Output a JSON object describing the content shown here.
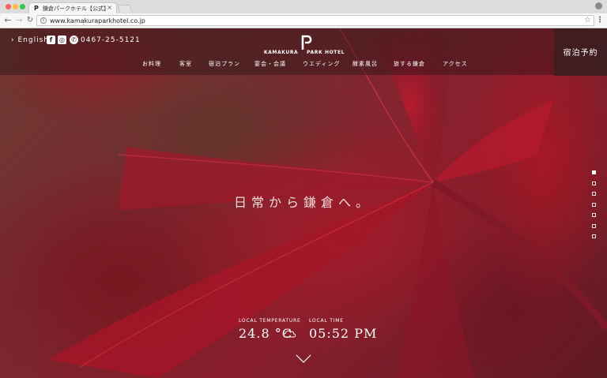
{
  "browser": {
    "tab_title": "鎌倉パークホテル【公式】 | Ka",
    "tab_close": "×",
    "url": "www.kamakuraparkhotel.co.jp",
    "icons": [
      "back-icon",
      "forward-icon",
      "reload-icon",
      "info-icon",
      "star-icon",
      "menu-icon",
      "profile-icon"
    ]
  },
  "header": {
    "lang_link": "› English",
    "phone": "0467-25-5121",
    "logo_top": "KAMAKURA",
    "logo_bottom": "PARK HOTEL",
    "reserve_label": "宿泊予約",
    "social_icons": [
      "facebook-icon",
      "instagram-icon",
      "phone-icon"
    ]
  },
  "nav": {
    "items": [
      "お料理",
      "客室",
      "宿泊プラン",
      "宴会・会議",
      "ウエディング",
      "酵素風呂",
      "旅する鎌倉",
      "アクセス"
    ]
  },
  "hero": {
    "tagline": "日常から鎌倉へ。",
    "slide_count": 7,
    "active_slide": 1
  },
  "weather": {
    "temp_label": "LOCAL TEMPERATURE",
    "temp_value": "24.8 °C",
    "time_label": "LOCAL TIME",
    "time_value": "05:52 PM",
    "condition_icon": "cloud-icon"
  },
  "colors": {
    "header_overlay": "#281416",
    "reserve_bg": "#3c1e20",
    "leaf_red": "#b8182c"
  }
}
